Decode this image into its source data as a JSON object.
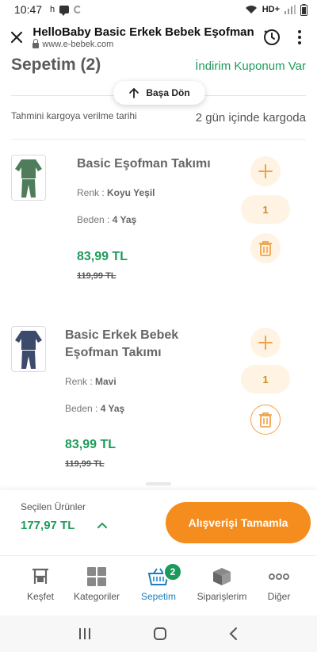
{
  "status_bar": {
    "time": "10:47",
    "notif_letter": "h",
    "network": "HD+"
  },
  "browser": {
    "title": "HelloBaby Basic Erkek Bebek Eşofman",
    "url": "www.e-bebek.com"
  },
  "cart": {
    "title": "Sepetim (2)",
    "coupon_link": "İndirim Kuponum Var",
    "back_to_top": "Başa Dön",
    "cargo_label": "Tahmini kargoya verilme tarihi",
    "cargo_value": "2 gün içinde kargoda"
  },
  "items": [
    {
      "name": "Basic Eşofman Takımı",
      "color_label": "Renk : ",
      "color_value": "Koyu Yeşil",
      "size_label": "Beden : ",
      "size_value": "4 Yaş",
      "price": "83,99 TL",
      "old_price": "119,99 TL",
      "qty": "1",
      "image_color": "#4f7d5b"
    },
    {
      "name_line1": "Basic Erkek Bebek",
      "name_line2": "Eşofman Takımı",
      "color_label": "Renk : ",
      "color_value": "Mavi",
      "size_label": "Beden : ",
      "size_value": "4 Yaş",
      "price": "83,99 TL",
      "old_price": "119,99 TL",
      "qty": "1",
      "image_color": "#3c4a6b"
    }
  ],
  "summary": {
    "selected_label": "Seçilen Ürünler",
    "total": "177,97 TL",
    "checkout": "Alışverişi Tamamla"
  },
  "tabs": [
    {
      "label": "Keşfet",
      "icon": "explore-icon"
    },
    {
      "label": "Kategoriler",
      "icon": "categories-icon"
    },
    {
      "label": "Sepetim",
      "icon": "basket-icon",
      "badge": "2",
      "active": true
    },
    {
      "label": "Siparişlerim",
      "icon": "box-icon"
    },
    {
      "label": "Diğer",
      "icon": "more-icon"
    }
  ],
  "colors": {
    "green": "#1e9b5a",
    "orange": "#f58c1e",
    "blue": "#1b7fc1"
  }
}
